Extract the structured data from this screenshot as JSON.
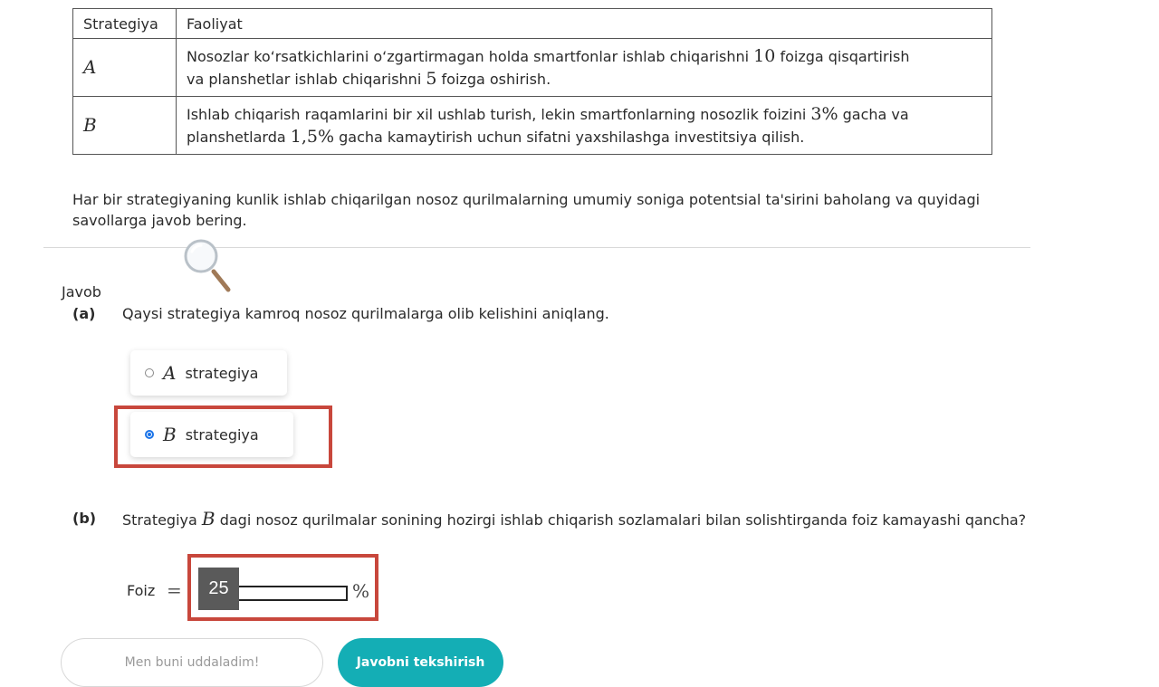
{
  "table": {
    "headers": [
      "Strategiya",
      "Faoliyat"
    ],
    "rows": [
      {
        "strategy": "A",
        "text_1": "Nosozlar ko‘rsatkichlarini o‘zgartirmagan holda smartfonlar ishlab chiqarishni",
        "num_1": "10",
        "text_2": "foizga qisqartirish",
        "text_3": "va planshetlar ishlab chiqarishni",
        "num_2": "5",
        "text_4": "foizga oshirish."
      },
      {
        "strategy": "B",
        "text_1": "Ishlab chiqarish raqamlarini bir xil ushlab turish, lekin smartfonlarning nosozlik foizini",
        "num_1": "3%",
        "text_2": "gacha va",
        "text_3": "planshetlarda",
        "num_2": "1,5%",
        "text_4": "gacha kamaytirish uchun sifatni yaxshilashga investitsiya qilish."
      }
    ]
  },
  "intro": "Har bir strategiyaning kunlik ishlab chiqarilgan nosoz qurilmalarning umumiy soniga potentsial ta'sirini baholang va quyidagi savollarga javob bering.",
  "answer_section": {
    "label": "Javob",
    "part_a": {
      "tag": "(a)",
      "question": "Qaysi strategiya kamroq nosoz qurilmalarga olib kelishini aniqlang.",
      "options": [
        {
          "letter": "A",
          "label": "strategiya",
          "selected": false
        },
        {
          "letter": "B",
          "label": "strategiya",
          "selected": true
        }
      ]
    },
    "part_b": {
      "tag": "(b)",
      "question_pre": "Strategiya",
      "question_letter": "B",
      "question_post": "dagi nosoz qurilmalar sonining hozirgi ishlab chiqarish sozlamalari bilan solishtirganda foiz kamayashi qancha?",
      "input_label": "Foiz",
      "equals": "=",
      "input_value": "25",
      "unit": "%"
    }
  },
  "buttons": {
    "self_done": "Men buni uddaladim!",
    "check": "Javobni tekshirish"
  },
  "colors": {
    "highlight": "#c8473c",
    "primary_button": "#14aeb5",
    "radio_selected": "#1a73e8"
  }
}
